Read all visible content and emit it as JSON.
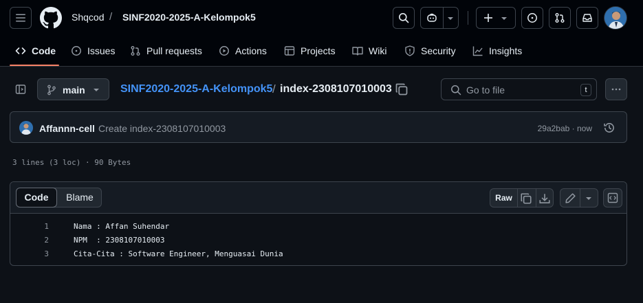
{
  "header": {
    "owner": "Shqcod",
    "separator": "/",
    "repo": "SINF2020-2025-A-Kelompok5"
  },
  "repo_nav": [
    {
      "label": "Code",
      "icon": "code-icon",
      "active": true
    },
    {
      "label": "Issues",
      "icon": "issue-opened-icon"
    },
    {
      "label": "Pull requests",
      "icon": "git-pull-request-icon"
    },
    {
      "label": "Actions",
      "icon": "play-icon"
    },
    {
      "label": "Projects",
      "icon": "table-icon"
    },
    {
      "label": "Wiki",
      "icon": "book-icon"
    },
    {
      "label": "Security",
      "icon": "shield-icon"
    },
    {
      "label": "Insights",
      "icon": "graph-icon"
    }
  ],
  "file_header": {
    "branch": "main",
    "repo_link": "SINF2020-2025-A-Kelompok5",
    "path_separator": "/",
    "file_name": "index-2308107010003",
    "goto_placeholder": "Go to file",
    "goto_shortcut": "t"
  },
  "commit": {
    "author": "Affannn-cell",
    "message": "Create index-2308107010003",
    "meta": "29a2bab · now"
  },
  "file_info": "3 lines (3 loc) · 90 Bytes",
  "code_view": {
    "tabs": {
      "code": "Code",
      "blame": "Blame"
    },
    "raw_label": "Raw",
    "lines": [
      {
        "n": "1",
        "text": "Nama : Affan Suhendar"
      },
      {
        "n": "2",
        "text": "NPM  : 2308107010003"
      },
      {
        "n": "3",
        "text": "Cita-Cita : Software Engineer, Menguasai Dunia"
      }
    ]
  },
  "colors": {
    "background": "#0d1117",
    "header_bg": "#010409",
    "link": "#4493f8",
    "active_underline": "#f78166",
    "muted": "#9198a1",
    "border": "#3d444d"
  }
}
